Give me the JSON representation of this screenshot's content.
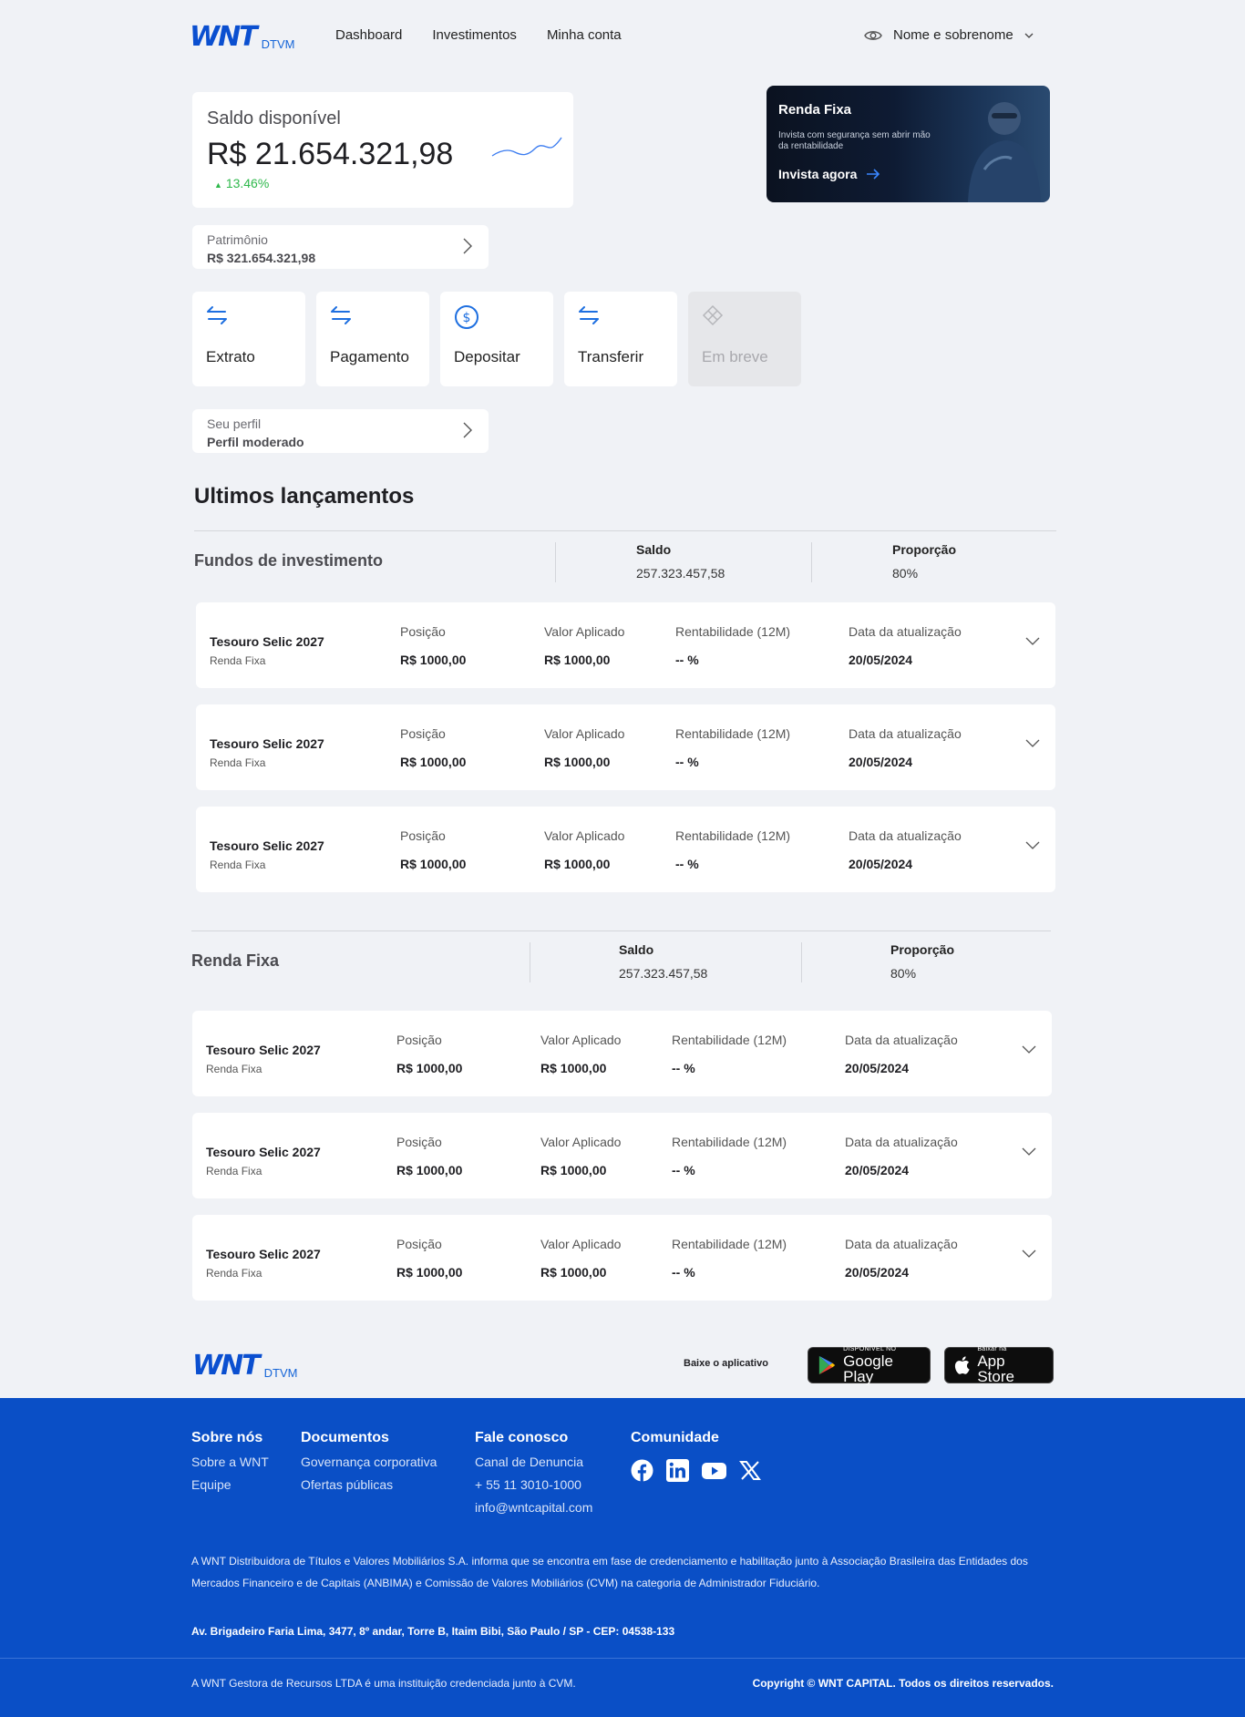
{
  "brand": {
    "mark": "WNT",
    "sub": "DTVM",
    "color": "#0a4fd0"
  },
  "nav": {
    "items": [
      "Dashboard",
      "Investimentos",
      "Minha conta"
    ]
  },
  "user": {
    "name": "Nome e sobrenome",
    "visibility_icon": "eye-icon"
  },
  "balance": {
    "label": "Saldo disponível",
    "value": "R$ 21.654.321,98",
    "variation": "13.46%",
    "variation_color": "#2eb84b"
  },
  "promo": {
    "title": "Renda Fixa",
    "description": "Invista com segurança sem abrir mão da rentabilidade",
    "cta": "Invista agora"
  },
  "patrimonio": {
    "label": "Patrimônio",
    "value": "R$ 321.654.321,98"
  },
  "actions": [
    {
      "label": "Extrato",
      "icon": "transfer-arrows-icon",
      "enabled": true
    },
    {
      "label": "Pagamento",
      "icon": "transfer-arrows-icon",
      "enabled": true
    },
    {
      "label": "Depositar",
      "icon": "dollar-circle-icon",
      "enabled": true
    },
    {
      "label": "Transferir",
      "icon": "transfer-arrows-icon",
      "enabled": true
    },
    {
      "label": "Em breve",
      "icon": "diamond-icon",
      "enabled": false
    }
  ],
  "profile": {
    "label": "Seu perfil",
    "value": "Perfil moderado"
  },
  "section_title": "Ultimos lançamentos",
  "columns": {
    "saldo": "Saldo",
    "proporcao": "Proporção",
    "posicao": "Posição",
    "valor_aplicado": "Valor Aplicado",
    "rentabilidade": "Rentabilidade (12M)",
    "data": "Data da atualização"
  },
  "groups": [
    {
      "name": "Fundos de investimento",
      "saldo": "257.323.457,58",
      "proporcao": "80%",
      "assets": [
        {
          "name": "Tesouro Selic 2027",
          "type": "Renda Fixa",
          "posicao": "R$ 1000,00",
          "valor_aplicado": "R$ 1000,00",
          "rentabilidade": "-- %",
          "data": "20/05/2024"
        },
        {
          "name": "Tesouro Selic 2027",
          "type": "Renda Fixa",
          "posicao": "R$ 1000,00",
          "valor_aplicado": "R$ 1000,00",
          "rentabilidade": "-- %",
          "data": "20/05/2024"
        },
        {
          "name": "Tesouro Selic 2027",
          "type": "Renda Fixa",
          "posicao": "R$ 1000,00",
          "valor_aplicado": "R$ 1000,00",
          "rentabilidade": "-- %",
          "data": "20/05/2024"
        }
      ]
    },
    {
      "name": "Renda Fixa",
      "saldo": "257.323.457,58",
      "proporcao": "80%",
      "assets": [
        {
          "name": "Tesouro Selic 2027",
          "type": "Renda Fixa",
          "posicao": "R$ 1000,00",
          "valor_aplicado": "R$ 1000,00",
          "rentabilidade": "-- %",
          "data": "20/05/2024"
        },
        {
          "name": "Tesouro Selic 2027",
          "type": "Renda Fixa",
          "posicao": "R$ 1000,00",
          "valor_aplicado": "R$ 1000,00",
          "rentabilidade": "-- %",
          "data": "20/05/2024"
        },
        {
          "name": "Tesouro Selic 2027",
          "type": "Renda Fixa",
          "posicao": "R$ 1000,00",
          "valor_aplicado": "R$ 1000,00",
          "rentabilidade": "-- %",
          "data": "20/05/2024"
        }
      ]
    }
  ],
  "app_download": {
    "label": "Baixe o aplicativo",
    "google_play": {
      "small": "DISPONÍVEL NO",
      "big": "Google Play"
    },
    "app_store": {
      "small": "Baixar na",
      "big": "App Store"
    }
  },
  "footer": {
    "columns": [
      {
        "title": "Sobre nós",
        "links": [
          "Sobre a WNT",
          "Equipe"
        ]
      },
      {
        "title": "Documentos",
        "links": [
          "Governança corporativa",
          "Ofertas públicas"
        ]
      },
      {
        "title": "Fale conosco",
        "links": [
          "Canal de Denuncia",
          "+ 55 11 3010-1000",
          "info@wntcapital.com"
        ]
      }
    ],
    "community_title": "Comunidade",
    "social_icons": [
      "facebook-icon",
      "linkedin-icon",
      "youtube-icon",
      "x-icon"
    ],
    "legal": "A WNT Distribuidora de Títulos e Valores Mobiliários S.A. informa que se encontra em fase de credenciamento e habilitação junto à Associação Brasileira das Entidades dos Mercados Financeiro e de Capitais (ANBIMA) e Comissão de Valores Mobiliários (CVM) na categoria de Administrador Fiduciário.",
    "address": "Av. Brigadeiro Faria Lima, 3477, 8º andar, Torre B, Itaim Bibi, São Paulo / SP - CEP: 04538-133",
    "cvm_note": "A WNT Gestora de Recursos LTDA é uma instituição credenciada junto à CVM.",
    "copyright": "Copyright © WNT CAPITAL. Todos os direitos reservados.",
    "bg_color": "#0a4fc6"
  }
}
